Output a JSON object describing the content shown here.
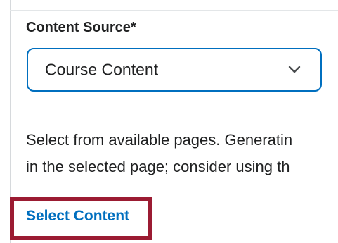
{
  "content_source": {
    "label": "Content Source*",
    "selected_value": "Course Content"
  },
  "description": {
    "line1": "Select from available pages. Generatin",
    "line2": "in the selected page; consider using th"
  },
  "select_content_link": "Select Content",
  "colors": {
    "accent": "#006fbf",
    "highlight_border": "#9b1b32",
    "text": "#202122"
  }
}
